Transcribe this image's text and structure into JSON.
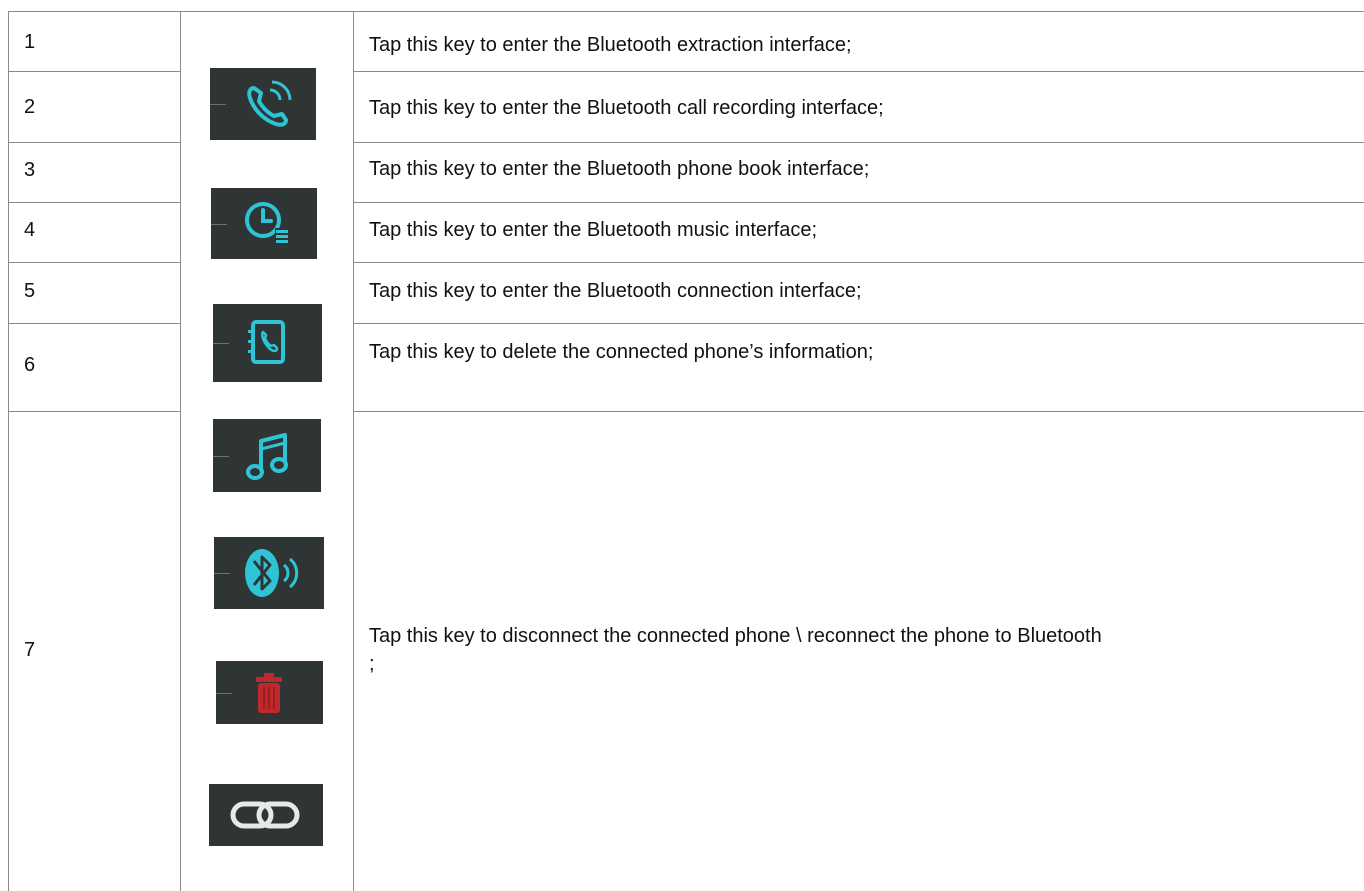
{
  "table": {
    "rows": [
      {
        "num": "1",
        "description": "Tap this key to enter the Bluetooth extraction interface;"
      },
      {
        "num": "2",
        "description": "Tap this key to enter the Bluetooth call recording interface;"
      },
      {
        "num": "3",
        "description": "Tap this key to enter the Bluetooth phone book interface;"
      },
      {
        "num": "4",
        "description": "Tap this key to enter the Bluetooth music interface;"
      },
      {
        "num": "5",
        "description": "Tap this key to enter the Bluetooth connection interface;"
      },
      {
        "num": "6",
        "description": "Tap this key to delete the connected phone’s information;"
      },
      {
        "num": "7",
        "description_line1": "Tap this key to disconnect the connected phone \\ reconnect the phone to Bluetooth",
        "description_line2": ";"
      }
    ],
    "icons": [
      {
        "name": "phone-call-icon"
      },
      {
        "name": "call-history-clock-icon"
      },
      {
        "name": "phone-book-icon"
      },
      {
        "name": "music-note-icon"
      },
      {
        "name": "bluetooth-speaker-icon"
      },
      {
        "name": "trash-icon"
      },
      {
        "name": "link-icon"
      }
    ],
    "colors": {
      "icon_background": "#2f3535",
      "icon_accent": "#2ec4d6",
      "delete_accent": "#c0282b",
      "border": "#8a8a8a"
    }
  }
}
